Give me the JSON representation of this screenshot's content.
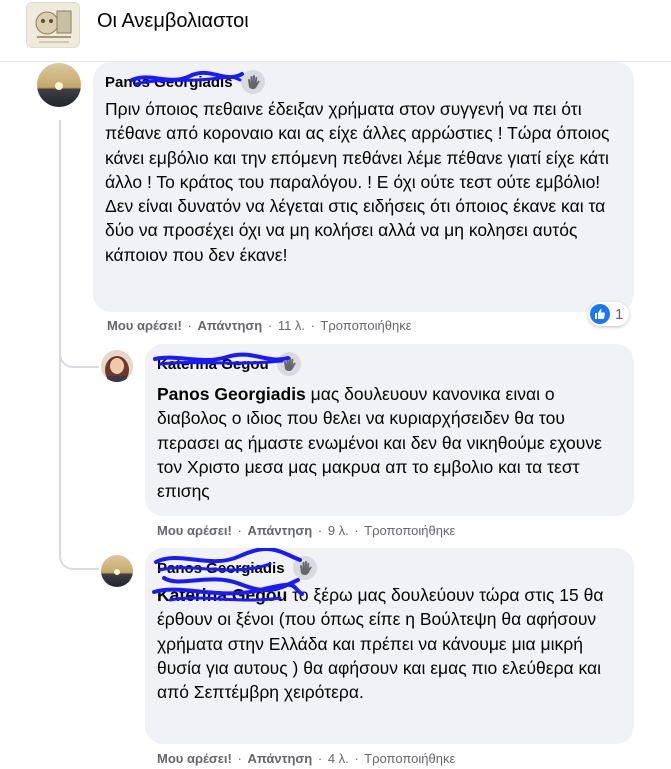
{
  "group": {
    "title": "Οι Ανεμβολιαστοι"
  },
  "comments": [
    {
      "author": "Panos Georgiadis",
      "text": "Πριν όποιος πεθαινε έδειξαν χρήματα στον συγγενή να πει ότι πέθανε από κοροναιο και ας είχε άλλες αρρώστιες ! Τώρα όποιος κάνει εμβόλιο και την επόμενη πεθάνει λέμε πέθανε γιατί είχε κάτι άλλο ! Το κράτος του παραλόγου. ! Ε όχι ούτε τεστ ούτε εμβόλιο! Δεν είναι δυνατόν να λέγεται στις ειδήσεις ότι όποιος έκανε και τα δύο να προσέχει όχι να μη κολήσει αλλά να μη κολησει αυτός κάποιον που δεν έκανε!",
      "like": "Μου αρέσει!",
      "reply": "Απάντηση",
      "time": "11 λ.",
      "edited": "Τροποποιήθηκε",
      "reaction_count": "1"
    },
    {
      "author": "Katerina Gegou",
      "mention": "Panos Georgiadis",
      "text": " μας δουλευουν κανονικα ειναι ο διαβολος ο ιδιος που θελει να κυριαρχήσειδεν θα του περασει ας ήμαστε ενωμένοι και δεν θα νικηθούμε εχουνε τον Χριστο μεσα μας μακρυα απ το εμβολιο και τα τεστ επισης",
      "like": "Μου αρέσει!",
      "reply": "Απάντηση",
      "time": "9 λ.",
      "edited": "Τροποποιήθηκε"
    },
    {
      "author": "Panos Georgiadis",
      "mention": "Katerina Gegou",
      "text": " το ξέρω μας δουλεύουν τώρα στις 15 θα έρθουν οι ξένοι (που όπως είπε η Βούλτεψη θα αφήσουν χρήματα στην Ελλάδα και πρέπει να κάνουμε μια μικρή θυσία για αυτους ) θα αφήσουν και εμας πιο ελεύθερα και από Σεπτέμβρη χειρότερα.",
      "like": "Μου αρέσει!",
      "reply": "Απάντηση",
      "time": "4 λ.",
      "edited": "Τροποποιήθηκε"
    }
  ],
  "colors": {
    "bubble": "#f0f2f5",
    "meta": "#65676b",
    "like_blue": "#1877f2",
    "scribble_blue": "#1a1aff"
  },
  "icons": {
    "reaction": "like-icon",
    "badge": "wave-hand-icon"
  }
}
